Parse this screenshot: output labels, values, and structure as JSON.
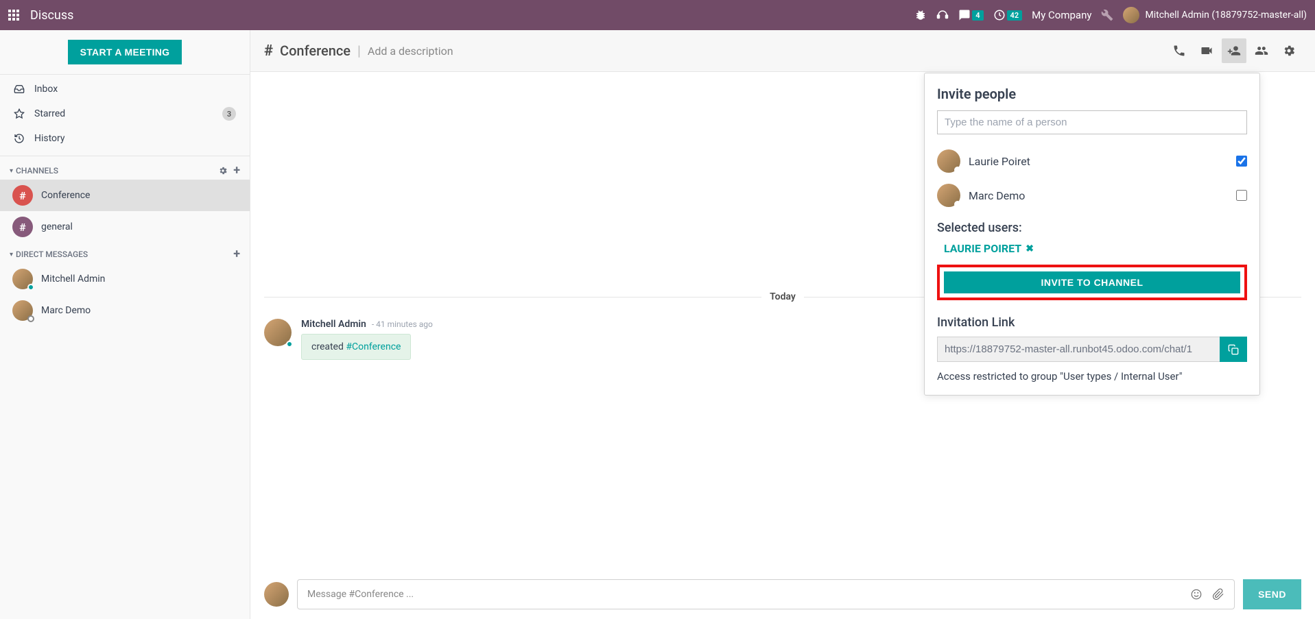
{
  "navbar": {
    "title": "Discuss",
    "messages_badge": "4",
    "activities_badge": "42",
    "company": "My Company",
    "user_name": "Mitchell Admin (18879752-master-all)"
  },
  "sidebar": {
    "start_meeting": "START A MEETING",
    "inbox": "Inbox",
    "starred": "Starred",
    "starred_count": "3",
    "history": "History",
    "channels_header": "CHANNELS",
    "channels": [
      {
        "name": "Conference",
        "color": "ch-red",
        "active": true
      },
      {
        "name": "general",
        "color": "ch-purple",
        "active": false
      }
    ],
    "dm_header": "DIRECT MESSAGES",
    "dms": [
      {
        "name": "Mitchell Admin",
        "status": "st-online"
      },
      {
        "name": "Marc Demo",
        "status": "st-away"
      }
    ]
  },
  "header": {
    "hash": "#",
    "channel_name": "Conference",
    "description_placeholder": "Add a description"
  },
  "thread": {
    "today": "Today",
    "author": "Mitchell Admin",
    "time": "- 41 minutes ago",
    "created_text": "created ",
    "created_link": "#Conference"
  },
  "composer": {
    "placeholder": "Message #Conference ...",
    "send": "SEND"
  },
  "invite": {
    "title": "Invite people",
    "search_placeholder": "Type the name of a person",
    "people": [
      {
        "name": "Laurie Poiret",
        "checked": true
      },
      {
        "name": "Marc Demo",
        "checked": false
      }
    ],
    "selected_title": "Selected users:",
    "selected_tag": "LAURIE POIRET",
    "button": "INVITE TO CHANNEL",
    "link_title": "Invitation Link",
    "link_value": "https://18879752-master-all.runbot45.odoo.com/chat/1",
    "access_note": "Access restricted to group \"User types / Internal User\""
  }
}
